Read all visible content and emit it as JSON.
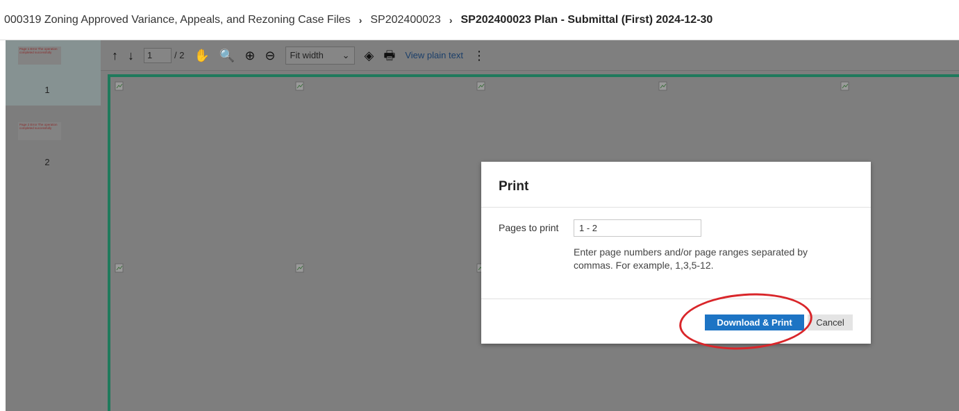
{
  "breadcrumb": {
    "items": [
      "000319 Zoning Approved Variance, Appeals, and Rezoning Case Files",
      "SP202400023"
    ],
    "separator": "›",
    "current": "SP202400023 Plan - Submittal (First) 2024-12-30"
  },
  "thumbnails": [
    {
      "number": "1",
      "preview_text": "Page 1 Error The operation completed successfully"
    },
    {
      "number": "2",
      "preview_text": "Page 2 Error The operation completed successfully"
    }
  ],
  "toolbar": {
    "prev_icon": "↑",
    "next_icon": "↓",
    "page_value": "1",
    "page_total": "/ 2",
    "pan_icon": "✋",
    "search_icon": "🔍",
    "zoom_in_icon": "⊕",
    "zoom_out_icon": "⊖",
    "zoom_selected": "Fit width",
    "dropdown_icon": "⌄",
    "rotate_icon": "◈",
    "print_icon": "🖶",
    "view_plain_text": "View plain text",
    "more_icon": "⋮"
  },
  "modal": {
    "title": "Print",
    "pages_label": "Pages to print",
    "pages_value": "1 - 2",
    "help_text": "Enter page numbers and/or page ranges separated by commas. For example, 1,3,5-12.",
    "primary_button": "Download & Print",
    "cancel_button": "Cancel"
  },
  "colors": {
    "primary": "#1d74c4",
    "frame": "#1f7a5c",
    "annotation": "#d9262a"
  }
}
